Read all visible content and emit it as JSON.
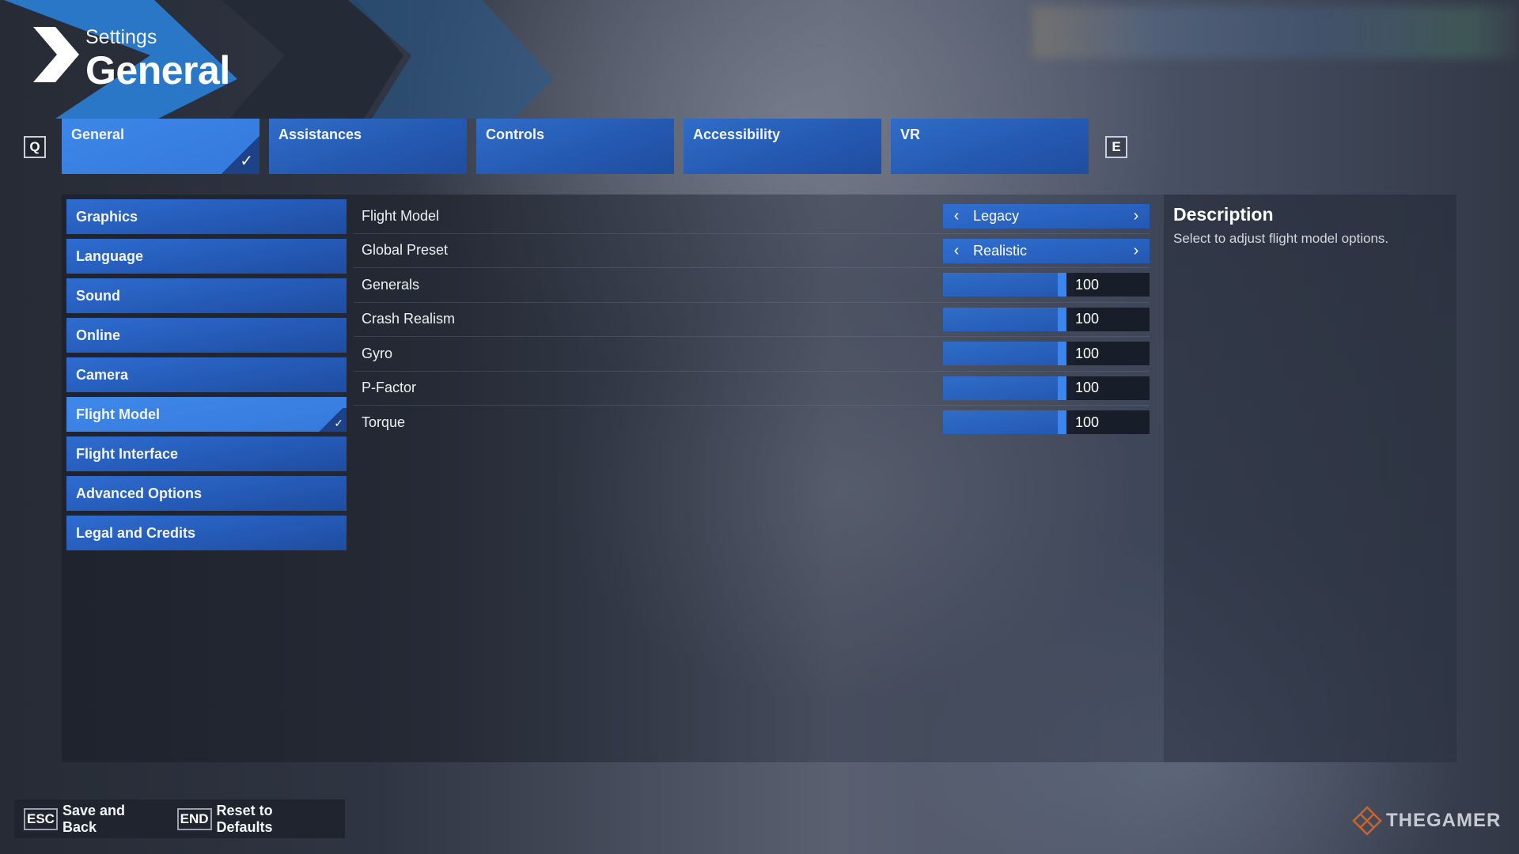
{
  "header": {
    "subtitle": "Settings",
    "title": "General"
  },
  "tab_prev_key": "Q",
  "tab_next_key": "E",
  "tabs": [
    {
      "label": "General",
      "active": true
    },
    {
      "label": "Assistances",
      "active": false
    },
    {
      "label": "Controls",
      "active": false
    },
    {
      "label": "Accessibility",
      "active": false
    },
    {
      "label": "VR",
      "active": false
    }
  ],
  "check_glyph": "✓",
  "sidebar": {
    "items": [
      {
        "label": "Graphics",
        "active": false
      },
      {
        "label": "Language",
        "active": false
      },
      {
        "label": "Sound",
        "active": false
      },
      {
        "label": "Online",
        "active": false
      },
      {
        "label": "Camera",
        "active": false
      },
      {
        "label": "Flight Model",
        "active": true
      },
      {
        "label": "Flight Interface",
        "active": false
      },
      {
        "label": "Advanced Options",
        "active": false
      },
      {
        "label": "Legal and Credits",
        "active": false
      }
    ]
  },
  "settings": {
    "rows": [
      {
        "label": "Flight Model",
        "type": "selector",
        "value": "Legacy"
      },
      {
        "label": "Global Preset",
        "type": "selector",
        "value": "Realistic"
      },
      {
        "label": "Generals",
        "type": "slider",
        "value": "100",
        "slider_fraction": 0.6
      },
      {
        "label": "Crash Realism",
        "type": "slider",
        "value": "100",
        "slider_fraction": 0.6
      },
      {
        "label": "Gyro",
        "type": "slider",
        "value": "100",
        "slider_fraction": 0.6
      },
      {
        "label": "P-Factor",
        "type": "slider",
        "value": "100",
        "slider_fraction": 0.6
      },
      {
        "label": "Torque",
        "type": "slider",
        "value": "100",
        "slider_fraction": 0.6
      }
    ],
    "prev_arrow": "‹",
    "next_arrow": "›"
  },
  "description": {
    "title": "Description",
    "text": "Select to adjust flight model options."
  },
  "bottom_bar": {
    "items": [
      {
        "key": "ESC",
        "label": "Save and Back"
      },
      {
        "key": "END",
        "label": "Reset to Defaults"
      }
    ]
  },
  "watermark": {
    "text": "THEGAMER"
  },
  "colors": {
    "accent": "#3479dc",
    "tab": "#2458b0",
    "watermark_logo": "#c8642e"
  }
}
